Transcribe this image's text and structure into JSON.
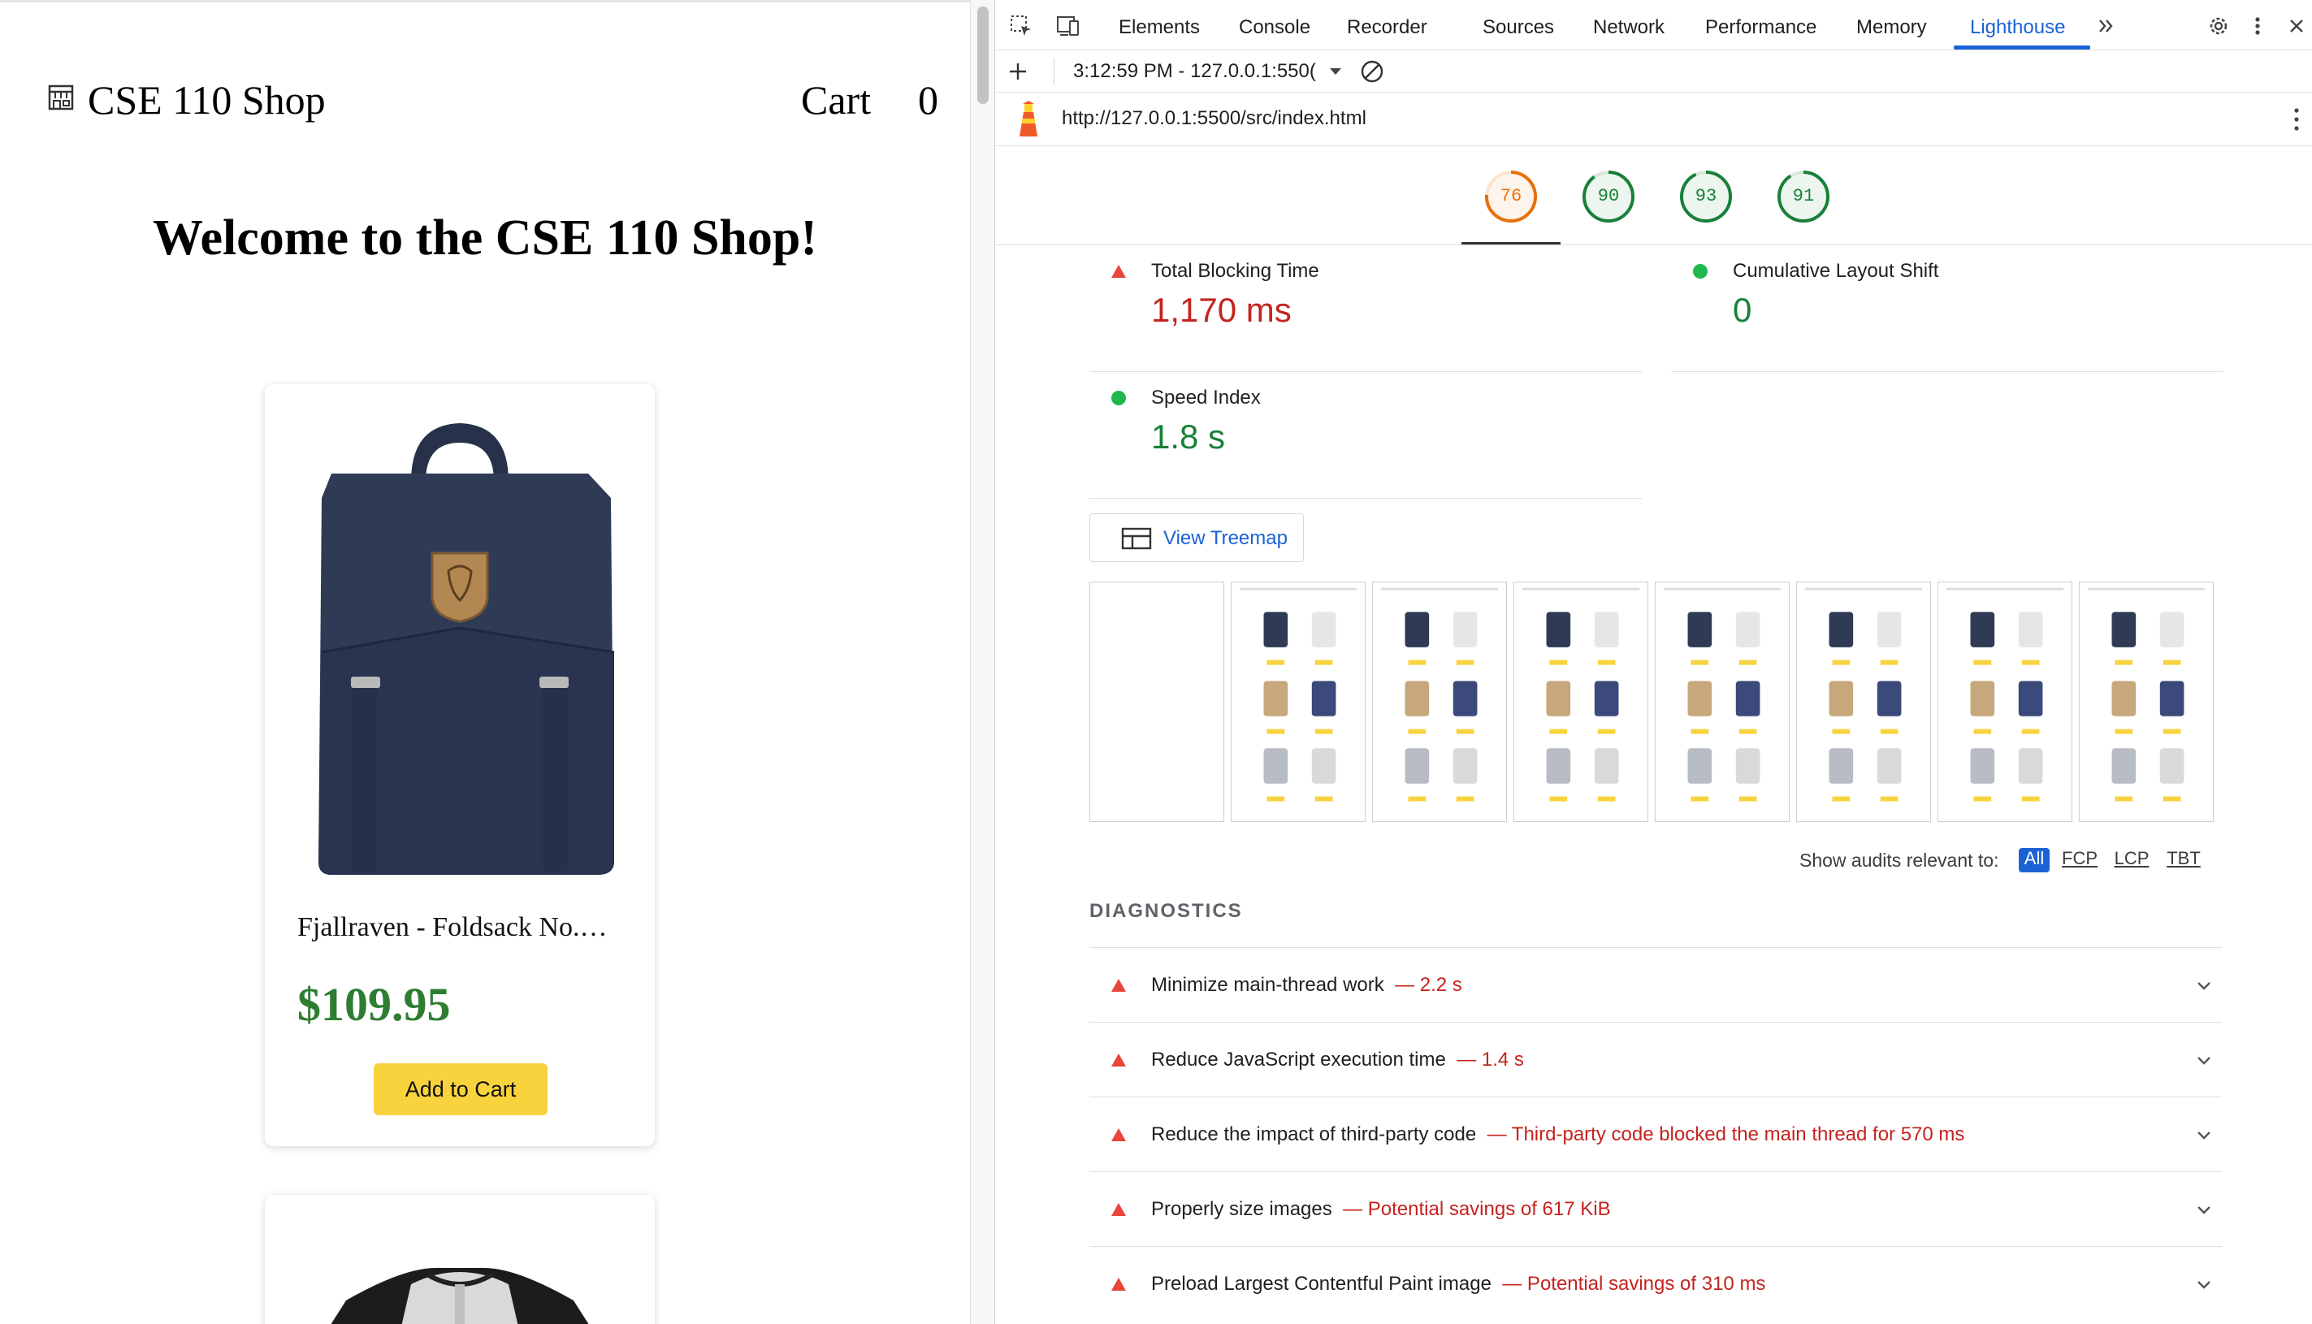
{
  "shop": {
    "title": "CSE 110 Shop",
    "cart_label": "Cart",
    "cart_count": "0",
    "welcome": "Welcome to the CSE 110 Shop!",
    "products": [
      {
        "name": "Fjallraven - Foldsack No.…",
        "price": "$109.95",
        "button": "Add to Cart"
      }
    ]
  },
  "devtools": {
    "tabs": [
      "Elements",
      "Console",
      "Recorder",
      "Sources",
      "Network",
      "Performance",
      "Memory",
      "Lighthouse"
    ],
    "active_tab": "Lighthouse",
    "report_selector": "3:12:59 PM - 127.0.0.1:550(",
    "url": "http://127.0.0.1:5500/src/index.html",
    "scores": [
      {
        "value": "76",
        "fraction": 0.76,
        "color": "#e8710a"
      },
      {
        "value": "90",
        "fraction": 0.9,
        "color": "#188038"
      },
      {
        "value": "93",
        "fraction": 0.93,
        "color": "#188038"
      },
      {
        "value": "91",
        "fraction": 0.91,
        "color": "#188038"
      }
    ],
    "metrics": [
      {
        "title": "Total Blocking Time",
        "value": "1,170 ms",
        "status": "fail",
        "color": "#c5221f"
      },
      {
        "title": "Cumulative Layout Shift",
        "value": "0",
        "status": "pass",
        "color": "#188038"
      },
      {
        "title": "Speed Index",
        "value": "1.8 s",
        "status": "pass",
        "color": "#188038"
      }
    ],
    "treemap_button": "View Treemap",
    "audit_filter": {
      "label": "Show audits relevant to:",
      "options": [
        "All",
        "FCP",
        "LCP",
        "TBT"
      ],
      "selected": "All"
    },
    "diagnostics_heading": "DIAGNOSTICS",
    "diagnostics": [
      {
        "title": "Minimize main-thread work",
        "detail": "— 2.2 s"
      },
      {
        "title": "Reduce JavaScript execution time",
        "detail": "— 1.4 s"
      },
      {
        "title": "Reduce the impact of third-party code",
        "detail": "— Third-party code blocked the main thread for 570 ms"
      },
      {
        "title": "Properly size images",
        "detail": "— Potential savings of 617 KiB"
      },
      {
        "title": "Preload Largest Contentful Paint image",
        "detail": "— Potential savings of 310 ms"
      }
    ]
  }
}
